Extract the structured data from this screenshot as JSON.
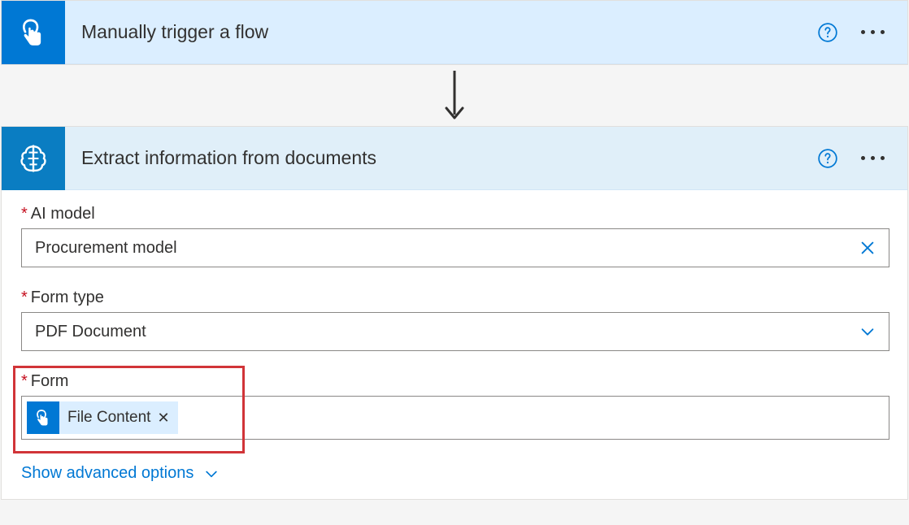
{
  "trigger": {
    "title": "Manually trigger a flow",
    "icon_name": "tap-icon"
  },
  "action": {
    "title": "Extract information from documents",
    "icon_name": "brain-icon",
    "fields": {
      "ai_model": {
        "label": "AI model",
        "value": "Procurement model",
        "required": true
      },
      "form_type": {
        "label": "Form type",
        "value": "PDF Document",
        "required": true
      },
      "form": {
        "label": "Form",
        "required": true,
        "token": {
          "label": "File Content",
          "source_icon": "tap-icon"
        }
      }
    },
    "advanced_link": "Show advanced options"
  }
}
